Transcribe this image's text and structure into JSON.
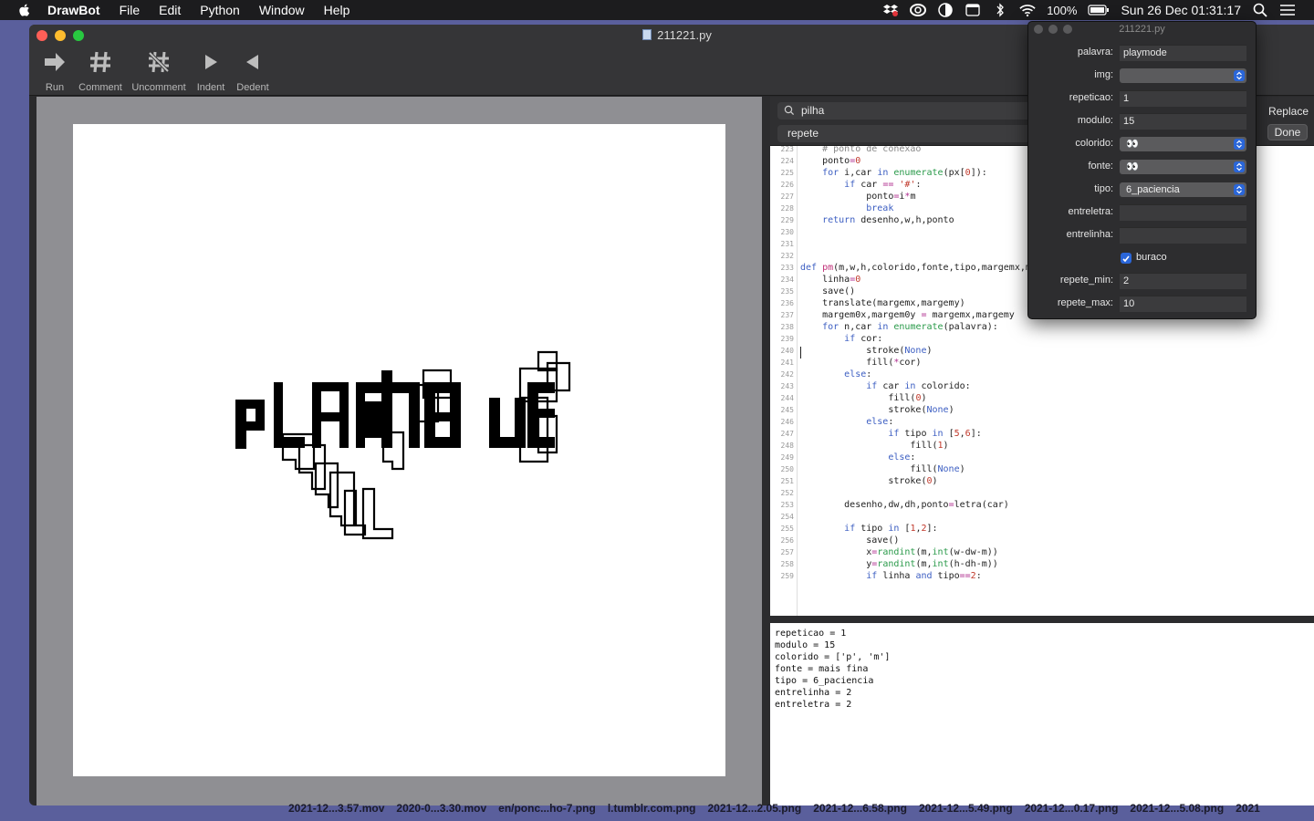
{
  "menubar": {
    "app": "DrawBot",
    "items": [
      "File",
      "Edit",
      "Python",
      "Window",
      "Help"
    ],
    "battery": "100%",
    "clock": "Sun 26 Dec  01:31:17"
  },
  "window": {
    "title": "211221.py",
    "toolbar": [
      {
        "label": "Run",
        "icon": "run-arrow-icon"
      },
      {
        "label": "Comment",
        "icon": "hash-icon"
      },
      {
        "label": "Uncomment",
        "icon": "hash-crossed-icon"
      },
      {
        "label": "Indent",
        "icon": "triangle-right-icon"
      },
      {
        "label": "Dedent",
        "icon": "triangle-left-icon"
      }
    ]
  },
  "canvas": {
    "drawn_word": "playmode"
  },
  "find": {
    "search": "pilha",
    "replace": "repete",
    "replace_label": "Replace",
    "done_label": "Done"
  },
  "code": {
    "lines": [
      {
        "n": "223",
        "t": "    # ponto de conexao"
      },
      {
        "n": "224",
        "t": "    ponto=0"
      },
      {
        "n": "225",
        "t": "    for i,car in enumerate(px[0]):"
      },
      {
        "n": "226",
        "t": "        if car == '#':"
      },
      {
        "n": "227",
        "t": "            ponto=i*m"
      },
      {
        "n": "228",
        "t": "            break"
      },
      {
        "n": "229",
        "t": "    return desenho,w,h,ponto"
      },
      {
        "n": "230",
        "t": ""
      },
      {
        "n": "231",
        "t": ""
      },
      {
        "n": "232",
        "t": ""
      },
      {
        "n": "233",
        "t": "def pm(m,w,h,colorido,fonte,tipo,margemx,margemy,palavra,cor=(),):"
      },
      {
        "n": "234",
        "t": "    linha=0"
      },
      {
        "n": "235",
        "t": "    save()"
      },
      {
        "n": "236",
        "t": "    translate(margemx,margemy)"
      },
      {
        "n": "237",
        "t": "    margem0x,margem0y = margemx,margemy"
      },
      {
        "n": "238",
        "t": "    for n,car in enumerate(palavra):"
      },
      {
        "n": "239",
        "t": "        if cor:"
      },
      {
        "n": "240",
        "t": "            stroke(None)"
      },
      {
        "n": "241",
        "t": "            fill(*cor)"
      },
      {
        "n": "242",
        "t": "        else:"
      },
      {
        "n": "243",
        "t": "            if car in colorido:"
      },
      {
        "n": "244",
        "t": "                fill(0)"
      },
      {
        "n": "245",
        "t": "                stroke(None)"
      },
      {
        "n": "246",
        "t": "            else:"
      },
      {
        "n": "247",
        "t": "                if tipo in [5,6]:"
      },
      {
        "n": "248",
        "t": "                    fill(1)"
      },
      {
        "n": "249",
        "t": "                else:"
      },
      {
        "n": "250",
        "t": "                    fill(None)"
      },
      {
        "n": "251",
        "t": "                stroke(0)"
      },
      {
        "n": "252",
        "t": ""
      },
      {
        "n": "253",
        "t": "        desenho,dw,dh,ponto=letra(car)"
      },
      {
        "n": "254",
        "t": ""
      },
      {
        "n": "255",
        "t": "        if tipo in [1,2]:"
      },
      {
        "n": "256",
        "t": "            save()"
      },
      {
        "n": "257",
        "t": "            x=randint(m,int(w-dw-m))"
      },
      {
        "n": "258",
        "t": "            y=randint(m,int(h-dh-m))"
      },
      {
        "n": "259",
        "t": "            if linha and tipo==2:"
      }
    ]
  },
  "output": {
    "lines": [
      "repeticao = 1",
      "modulo = 15",
      "colorido = ['p', 'm']",
      "fonte = mais fina",
      "tipo = 6_paciencia",
      "entrelinha = 2",
      "entreletra = 2"
    ]
  },
  "palette": {
    "title": "211221.py",
    "fields": [
      {
        "label": "palavra:",
        "kind": "text",
        "value": "playmode"
      },
      {
        "label": "img:",
        "kind": "select",
        "value": ""
      },
      {
        "label": "repeticao:",
        "kind": "text",
        "value": "1"
      },
      {
        "label": "modulo:",
        "kind": "text",
        "value": "15"
      },
      {
        "label": "colorido:",
        "kind": "select",
        "value": "👀"
      },
      {
        "label": "fonte:",
        "kind": "select",
        "value": "👀"
      },
      {
        "label": "tipo:",
        "kind": "select",
        "value": "6_paciencia"
      },
      {
        "label": "entreletra:",
        "kind": "text",
        "value": ""
      },
      {
        "label": "entrelinha:",
        "kind": "text",
        "value": ""
      },
      {
        "label": "",
        "kind": "checkbox",
        "value": "buraco"
      },
      {
        "label": "repete_min:",
        "kind": "text",
        "value": "2"
      },
      {
        "label": "repete_max:",
        "kind": "text",
        "value": "10"
      }
    ]
  },
  "desktop_files": [
    "2021-12...3.57.mov",
    "2020-0...3.30.mov",
    "en/ponc...ho-7.png",
    "l.tumblr.com.png",
    "2021-12...2.05.png",
    "2021-12...6.58.png",
    "2021-12...5.49.png",
    "2021-12...0.17.png",
    "2021-12...5.08.png",
    "2021"
  ]
}
